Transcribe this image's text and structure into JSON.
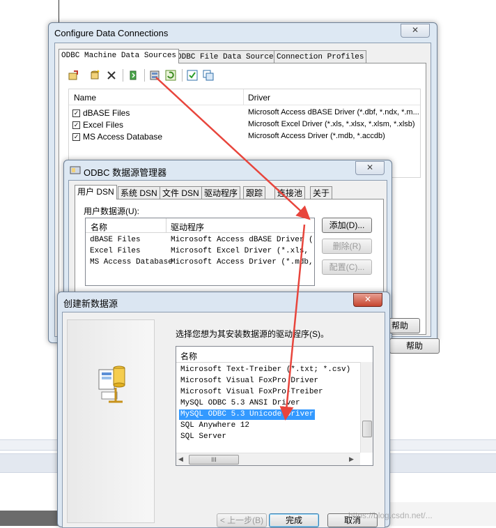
{
  "configure_window": {
    "title": "Configure Data Connections",
    "close": "✕",
    "tabs": [
      "ODBC Machine Data Sources",
      "ODBC File Data Sources",
      "Connection Profiles"
    ],
    "columns": {
      "name": "Name",
      "driver": "Driver"
    },
    "rows": [
      {
        "name": "dBASE Files",
        "driver": "Microsoft Access dBASE Driver (*.dbf, *.ndx, *.m..."
      },
      {
        "name": "Excel Files",
        "driver": "Microsoft Excel Driver (*.xls, *.xlsx, *.xlsm, *.xlsb)"
      },
      {
        "name": "MS Access Database",
        "driver": "Microsoft Access Driver (*.mdb, *.accdb)"
      }
    ],
    "toolbar_icons": [
      "import-icon",
      "new-icon",
      "delete-icon",
      "copy-icon",
      "odbc-admin-icon",
      "refresh-icon",
      "check-icon",
      "duplicate-icon"
    ]
  },
  "odbc_window": {
    "title": "ODBC 数据源管理器",
    "close": "✕",
    "tabs": [
      "用户 DSN",
      "系统 DSN",
      "文件 DSN",
      "驱动程序",
      "跟踪",
      "连接池",
      "关于"
    ],
    "section_label": "用户数据源(U):",
    "columns": {
      "name": "名称",
      "driver": "驱动程序"
    },
    "rows": [
      {
        "name": "dBASE Files",
        "driver": "Microsoft Access dBASE Driver (*.d"
      },
      {
        "name": "Excel Files",
        "driver": "Microsoft Excel Driver (*.xls, *.x"
      },
      {
        "name": "MS Access Database",
        "driver": "Microsoft Access Driver (*.mdb, *."
      }
    ],
    "buttons": {
      "add": "添加(D)...",
      "remove": "删除(R)",
      "configure": "配置(C)...",
      "help": "帮助"
    }
  },
  "create_window": {
    "title": "创建新数据源",
    "close": "✕",
    "prompt": "选择您想为其安装数据源的驱动程序(S)。",
    "column": "名称",
    "drivers": [
      "Microsoft Text-Treiber (*.txt; *.csv)",
      "Microsoft Visual FoxPro Driver",
      "Microsoft Visual FoxPro-Treiber",
      "MySQL ODBC 5.3 ANSI Driver",
      "MySQL ODBC 5.3 Unicode Driver",
      "SQL Anywhere 12",
      "SQL Server"
    ],
    "selected_driver": "MySQL ODBC 5.3 Unicode Driver",
    "buttons": {
      "back": "< 上一步(B)",
      "finish": "完成",
      "cancel": "取消"
    },
    "scroll_grip": "III"
  },
  "watermark": "https://blog.csdn.net/...",
  "colors": {
    "arrow": "#e8453c",
    "selection": "#3399ff"
  }
}
